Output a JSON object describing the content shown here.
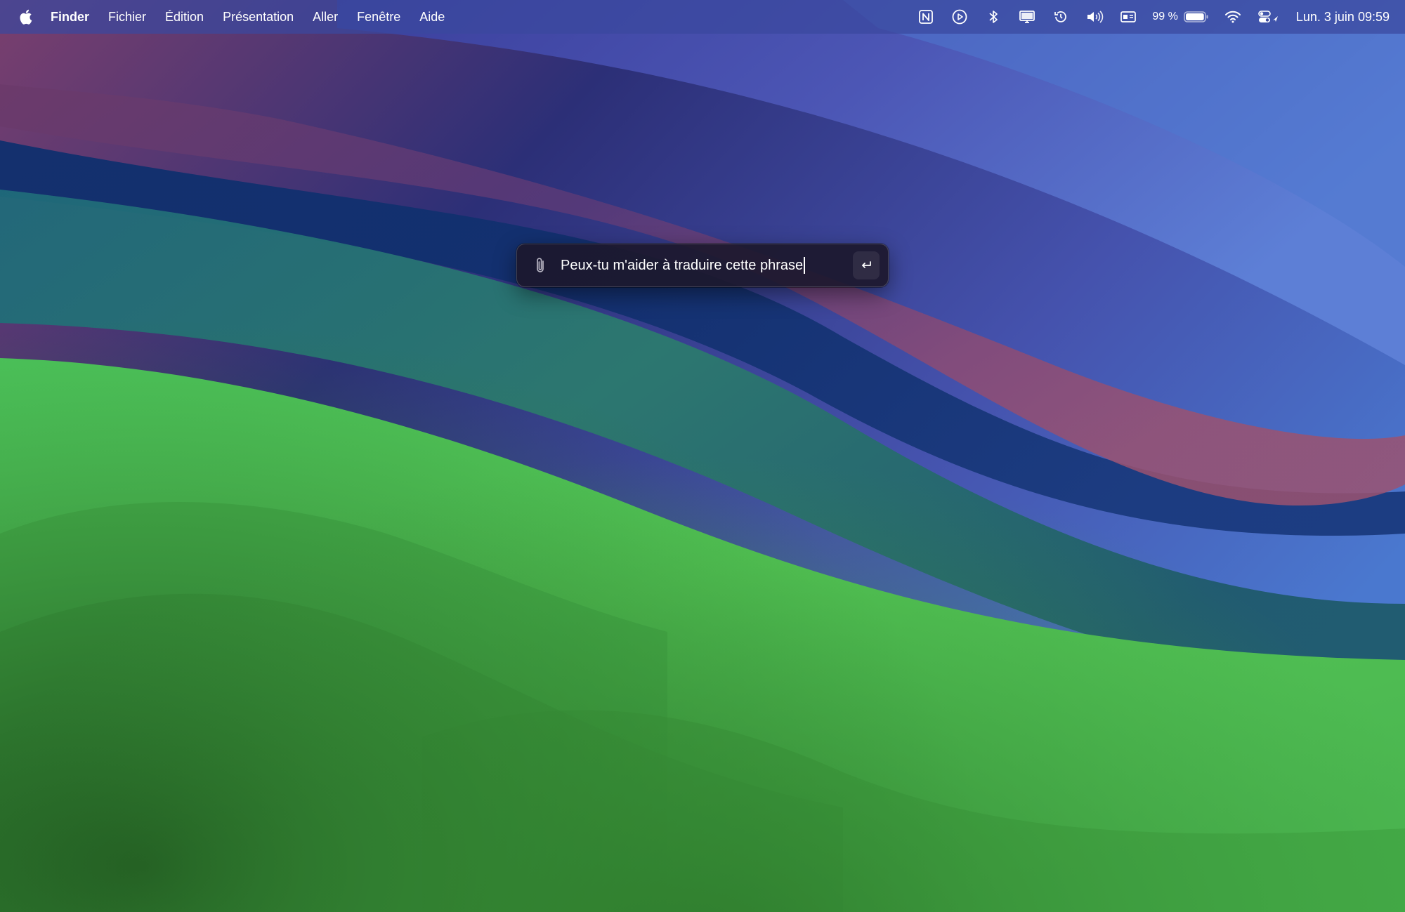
{
  "menubar": {
    "apple_icon": "apple-logo-icon",
    "app_name": "Finder",
    "menus": [
      "Fichier",
      "Édition",
      "Présentation",
      "Aller",
      "Fenêtre",
      "Aide"
    ],
    "status_icons": [
      "notion-icon",
      "screen-recording-icon",
      "bluetooth-icon",
      "display-icon",
      "time-machine-icon",
      "volume-icon",
      "keyboard-input-icon"
    ],
    "battery": {
      "percent_label": "99 %",
      "level": 0.99
    },
    "wifi_icon": "wifi-icon",
    "control_center_icon": "control-center-icon",
    "clock": "Lun. 3 juin  09:59"
  },
  "prompt": {
    "value": "Peux-tu m'aider à traduire cette phrase",
    "attach_icon": "paperclip-icon",
    "submit_icon": "return-icon"
  },
  "colors": {
    "menubar_bg": "#3a489e",
    "prompt_bg": "#1c182c",
    "wallpaper_green": "#56c957",
    "wallpaper_blue": "#1d3576",
    "wallpaper_pink": "#8a4a72",
    "wallpaper_violet": "#4b55b8"
  }
}
